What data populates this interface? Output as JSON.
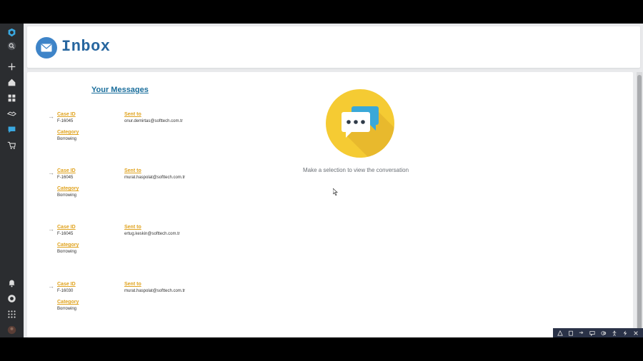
{
  "header": {
    "title": "Inbox",
    "icon": "envelope-icon"
  },
  "rail": {
    "items": [
      "logo-icon",
      "search-icon",
      "plus-icon",
      "home-icon",
      "grid-icon",
      "handshake-icon",
      "chat-icon",
      "cart-icon",
      "bell-icon",
      "help-icon",
      "apps-icon",
      "avatar"
    ],
    "active": "chat-icon"
  },
  "messages": {
    "title": "Your Messages",
    "items": [
      {
        "case_label": "Case ID",
        "case_id": "F-16045",
        "sent_label": "Sent to",
        "sent_to": "onur.demirtas@softtech.com.tr",
        "category_label": "Category",
        "category": "Borrowing"
      },
      {
        "case_label": "Case ID",
        "case_id": "F-16045",
        "sent_label": "Sent to",
        "sent_to": "murat.haspolat@softtech.com.tr",
        "category_label": "Category",
        "category": "Borrowing"
      },
      {
        "case_label": "Case ID",
        "case_id": "F-16045",
        "sent_label": "Sent to",
        "sent_to": "ertug.keskin@softtech.com.tr",
        "category_label": "Category",
        "category": "Borrowing"
      },
      {
        "case_label": "Case ID",
        "case_id": "F-16030",
        "sent_label": "Sent to",
        "sent_to": "murat.haspolat@softtech.com.tr",
        "category_label": "Category",
        "category": "Borrowing"
      }
    ]
  },
  "empty_state": {
    "text": "Make a selection to view the conversation",
    "icon": "chat-bubbles-icon"
  },
  "colors": {
    "accent": "#1a6e9c",
    "label": "#e0a21c",
    "illustration": "#f5cb33",
    "header_icon_bg": "#3e84c8"
  },
  "bottom_toolbar": {
    "icons": [
      "warning-icon",
      "clipboard-icon",
      "pointer-icon",
      "comment-icon",
      "layers-icon",
      "accessibility-icon",
      "bolt-icon",
      "close-icon"
    ]
  }
}
